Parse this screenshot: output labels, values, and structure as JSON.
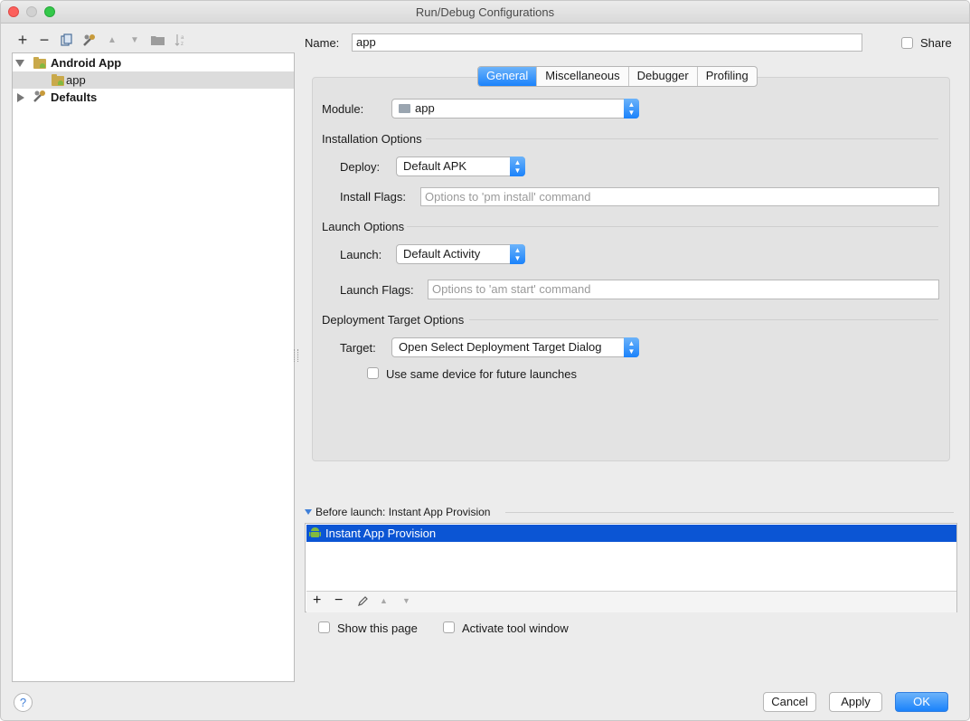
{
  "window": {
    "title": "Run/Debug Configurations"
  },
  "toolbar": {
    "icons": [
      "plus-icon",
      "minus-icon",
      "copy-icon",
      "wrench-icon",
      "arrow-up-icon",
      "arrow-down-icon",
      "folder-icon",
      "sort-icon"
    ],
    "add": "+",
    "remove": "−",
    "up": "▲",
    "down": "▼"
  },
  "tree": {
    "items": [
      {
        "label": "Android App",
        "expanded": true,
        "bold": true
      },
      {
        "label": "app",
        "selected": true
      },
      {
        "label": "Defaults",
        "expanded": false,
        "bold": true
      }
    ]
  },
  "config": {
    "name_label": "Name:",
    "name_value": "app",
    "share_label": "Share",
    "tabs": [
      {
        "label": "General",
        "active": true
      },
      {
        "label": "Miscellaneous"
      },
      {
        "label": "Debugger"
      },
      {
        "label": "Profiling"
      }
    ],
    "module_label": "Module:",
    "module_value": "app",
    "installation_options": "Installation Options",
    "deploy_label": "Deploy:",
    "deploy_value": "Default APK",
    "install_flags_label": "Install Flags:",
    "install_flags_placeholder": "Options to 'pm install' command",
    "launch_options": "Launch Options",
    "launch_label": "Launch:",
    "launch_value": "Default Activity",
    "launch_flags_label": "Launch Flags:",
    "launch_flags_placeholder": "Options to 'am start' command",
    "deployment_target_options": "Deployment Target Options",
    "target_label": "Target:",
    "target_value": "Open Select Deployment Target Dialog",
    "same_device_label": "Use same device for future launches"
  },
  "before_launch": {
    "header": "Before launch: Instant App Provision",
    "items": [
      "Instant App Provision"
    ],
    "tool_add": "+",
    "tool_remove": "−",
    "tool_up": "▲",
    "tool_down": "▼"
  },
  "options": {
    "show_page_label": "Show this page",
    "activate_tool_window_label": "Activate tool window"
  },
  "buttons": {
    "help": "?",
    "cancel": "Cancel",
    "apply": "Apply",
    "ok": "OK"
  },
  "colors": {
    "accent": "#1a82fb",
    "selection": "#0b55d4",
    "android_green": "#82b940"
  }
}
